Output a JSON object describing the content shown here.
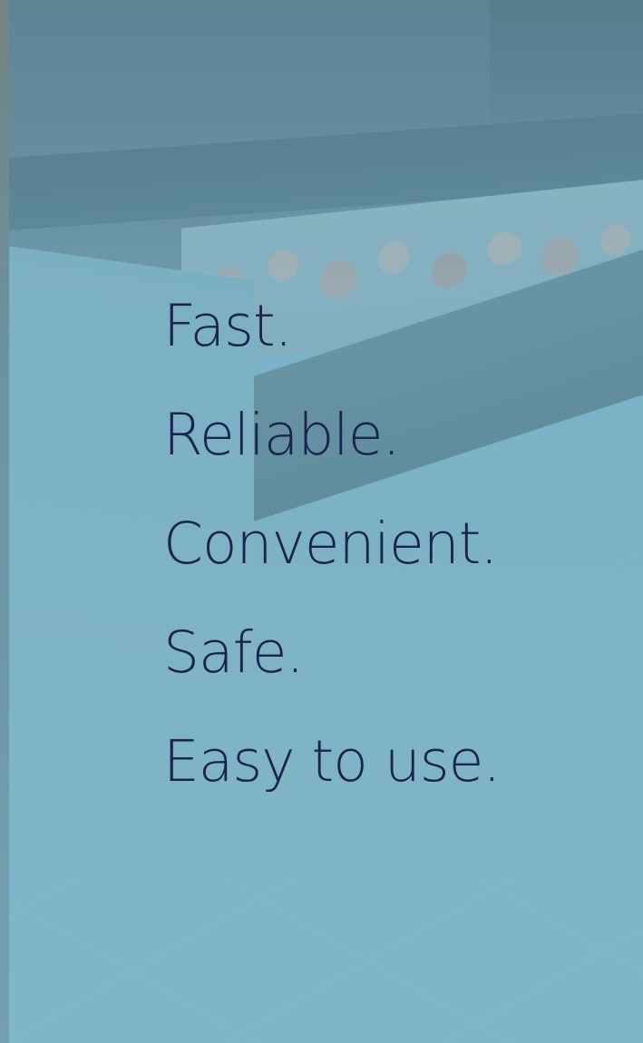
{
  "hero": {
    "background_description": "deli-counter",
    "overlay_color": "#78b4c8",
    "text_color": "#1b2450",
    "taglines": [
      "Fast.",
      "Reliable.",
      "Convenient.",
      "Safe.",
      "Easy to use."
    ]
  }
}
